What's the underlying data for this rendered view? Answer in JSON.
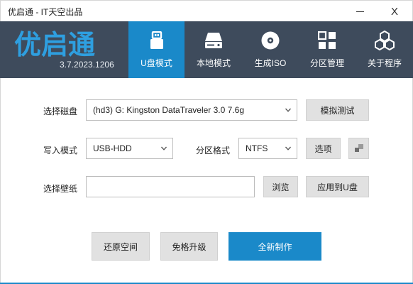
{
  "window": {
    "title": "优启通 - IT天空出品",
    "minimize_icon": "minimize-icon",
    "close_label": "X"
  },
  "brand": {
    "logo_text": "优启通",
    "version": "3.7.2023.1206",
    "logo_color": "#2e9fe0"
  },
  "tabs": [
    {
      "label": "U盘模式",
      "icon": "usb-drive-icon",
      "active": true
    },
    {
      "label": "本地模式",
      "icon": "hard-disk-icon",
      "active": false
    },
    {
      "label": "生成ISO",
      "icon": "disc-icon",
      "active": false
    },
    {
      "label": "分区管理",
      "icon": "partition-grid-icon",
      "active": false
    },
    {
      "label": "关于程序",
      "icon": "cubes-icon",
      "active": false
    }
  ],
  "form": {
    "disk": {
      "label": "选择磁盘",
      "value": "(hd3) G: Kingston DataTraveler 3.0 7.6g",
      "test_button": "模拟测试"
    },
    "write": {
      "label": "写入模式",
      "value": "USB-HDD"
    },
    "partition": {
      "label": "分区格式",
      "value": "NTFS",
      "options_button": "选项"
    },
    "wallpaper": {
      "label": "选择壁纸",
      "value": "",
      "browse_button": "浏览",
      "apply_button": "应用到U盘"
    }
  },
  "actions": {
    "restore": "还原空间",
    "upgrade": "免格升级",
    "create": "全新制作"
  },
  "colors": {
    "accent": "#1a89c9",
    "topbar": "#3e4b5c",
    "button": "#e1e1e1"
  }
}
